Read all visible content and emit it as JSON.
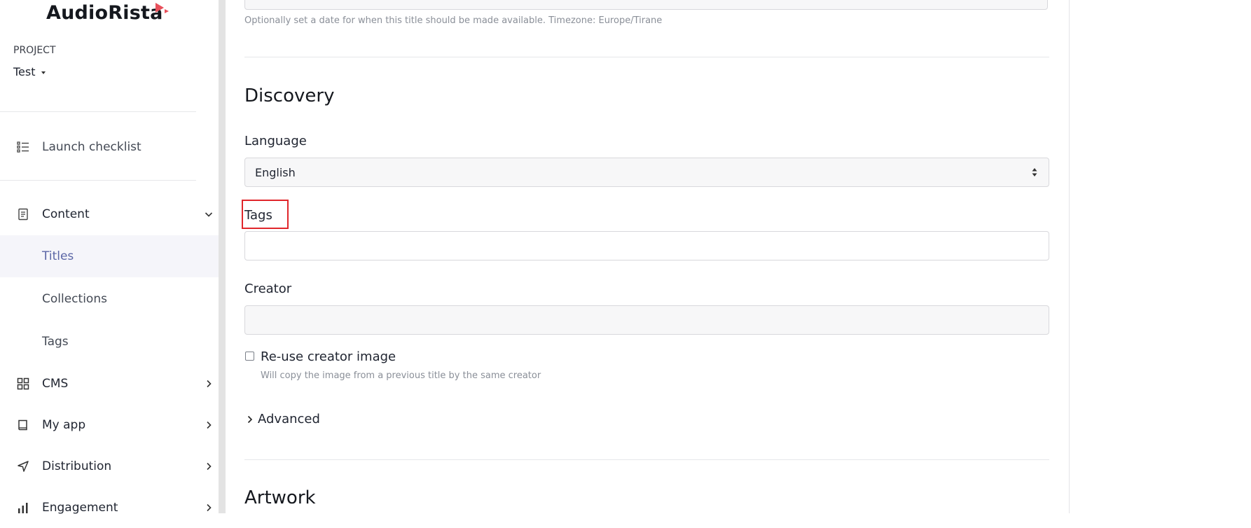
{
  "app": {
    "name": "AudioRista",
    "brand_color": "#e8505b"
  },
  "project": {
    "label": "PROJECT",
    "value": "Test"
  },
  "sidebar": {
    "launch_checklist": {
      "label": "Launch checklist",
      "icon": "checklist-icon"
    },
    "content": {
      "label": "Content",
      "icon": "document-icon",
      "expanded": true
    },
    "content_items": [
      {
        "label": "Titles",
        "active": true
      },
      {
        "label": "Collections",
        "active": false
      },
      {
        "label": "Tags",
        "active": false
      }
    ],
    "cms": {
      "label": "CMS",
      "icon": "grid-icon"
    },
    "my_app": {
      "label": "My app",
      "icon": "book-icon"
    },
    "distribution": {
      "label": "Distribution",
      "icon": "send-icon"
    },
    "engagement": {
      "label": "Engagement",
      "icon": "bar-chart-icon"
    },
    "active_color": "#5b66a6"
  },
  "form": {
    "availability_help": "Optionally set a date for when this title should be made available. Timezone: Europe/Tirane",
    "discovery": {
      "title": "Discovery",
      "language_label": "Language",
      "language_value": "English",
      "tags_label": "Tags",
      "tags_value": "",
      "creator_label": "Creator",
      "creator_value": "",
      "reuse_creator_label": "Re-use creator image",
      "reuse_creator_help": "Will copy the image from a previous title by the same creator",
      "reuse_creator_checked": false,
      "advanced_label": "Advanced"
    },
    "artwork": {
      "title": "Artwork"
    }
  },
  "highlight_color": "#e0262b"
}
